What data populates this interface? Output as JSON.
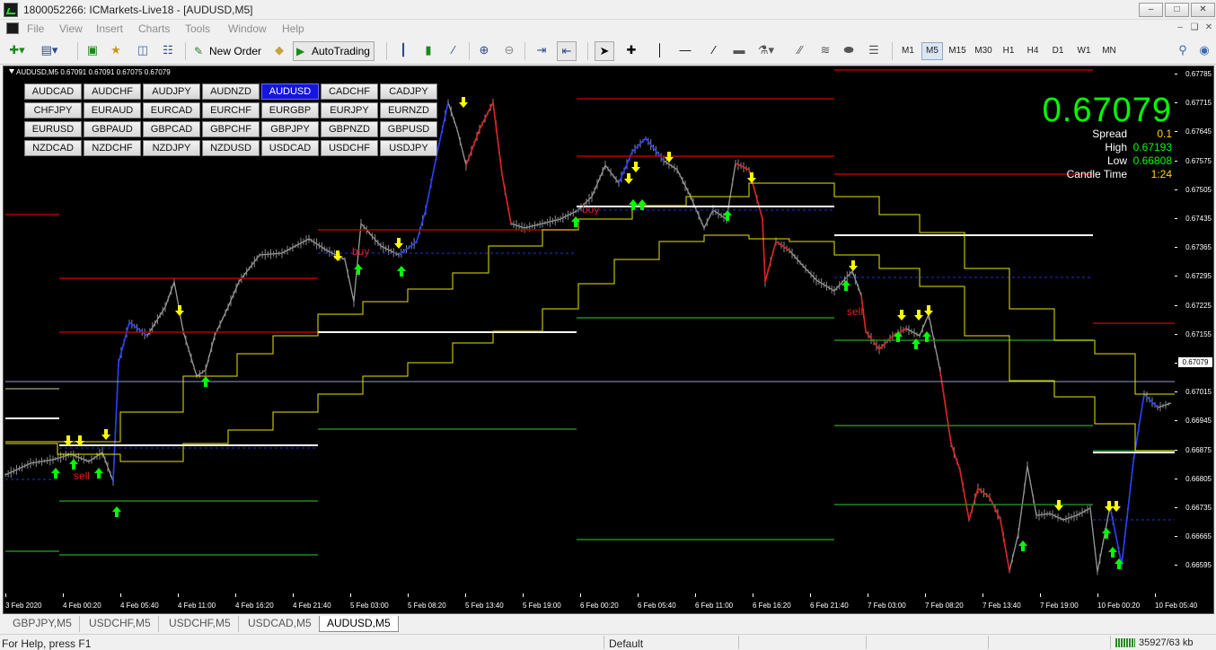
{
  "window": {
    "title": "1800052266: ICMarkets-Live18 - [AUDUSD,M5]"
  },
  "menu": [
    "File",
    "View",
    "Insert",
    "Charts",
    "Tools",
    "Window",
    "Help"
  ],
  "toolbar": {
    "new_order": "New Order",
    "autotrading": "AutoTrading"
  },
  "timeframes": [
    "M1",
    "M5",
    "M15",
    "M30",
    "H1",
    "H4",
    "D1",
    "W1",
    "MN"
  ],
  "active_timeframe": "M5",
  "chart": {
    "header": "AUDUSD,M5  0.67091 0.67091 0.67075 0.67079",
    "pairs": [
      "AUDCAD",
      "AUDCHF",
      "AUDJPY",
      "AUDNZD",
      "AUDUSD",
      "CADCHF",
      "CADJPY",
      "CHFJPY",
      "EURAUD",
      "EURCAD",
      "EURCHF",
      "EURGBP",
      "EURJPY",
      "EURNZD",
      "EURUSD",
      "GBPAUD",
      "GBPCAD",
      "GBPCHF",
      "GBPJPY",
      "GBPNZD",
      "GBPUSD",
      "NZDCAD",
      "NZDCHF",
      "NZDJPY",
      "NZDUSD",
      "USDCAD",
      "USDCHF",
      "USDJPY"
    ],
    "active_pair": "AUDUSD",
    "price": "0.67079",
    "info": {
      "spread_label": "Spread",
      "spread": "0.1",
      "high_label": "High",
      "high": "0.67193",
      "low_label": "Low",
      "low": "0.66808",
      "candle_label": "Candle Time",
      "candle": "1:24"
    },
    "y_ticks": [
      "0.67785",
      "0.67715",
      "0.67645",
      "0.67575",
      "0.67505",
      "0.67435",
      "0.67365",
      "0.67295",
      "0.67225",
      "0.67155",
      "0.67079",
      "0.67015",
      "0.66945",
      "0.66875",
      "0.66805",
      "0.66735",
      "0.66665",
      "0.66595"
    ],
    "current_price_label": "0.67079",
    "x_ticks": [
      "3 Feb 2020",
      "4 Feb 00:20",
      "4 Feb 05:40",
      "4 Feb 11:00",
      "4 Feb 16:20",
      "4 Feb 21:40",
      "5 Feb 03:00",
      "5 Feb 08:20",
      "5 Feb 13:40",
      "5 Feb 19:00",
      "6 Feb 00:20",
      "6 Feb 05:40",
      "6 Feb 11:00",
      "6 Feb 16:20",
      "6 Feb 21:40",
      "7 Feb 03:00",
      "7 Feb 08:20",
      "7 Feb 13:40",
      "7 Feb 19:00",
      "10 Feb 00:20",
      "10 Feb 05:40"
    ],
    "signals": {
      "buy": "buy",
      "sell": "sell"
    },
    "colors": {
      "price": "#00ff00",
      "high": "#00ff00",
      "low": "#00ff00",
      "spread": "#ffd700",
      "candle": "#ffd700",
      "resistance": "#b30000",
      "support": "#1f8a1f",
      "pivot": "#ffffff",
      "envelope": "#e6e600",
      "up_arrow": "#00ff00",
      "down_arrow": "#ffff00"
    }
  },
  "tabs": [
    "GBPJPY,M5",
    "USDCHF,M5",
    "USDCHF,M5",
    "USDCAD,M5",
    "AUDUSD,M5"
  ],
  "active_tab": "AUDUSD,M5",
  "status": {
    "help": "For Help, press F1",
    "profile": "Default",
    "memory": "35927/63 kb"
  }
}
